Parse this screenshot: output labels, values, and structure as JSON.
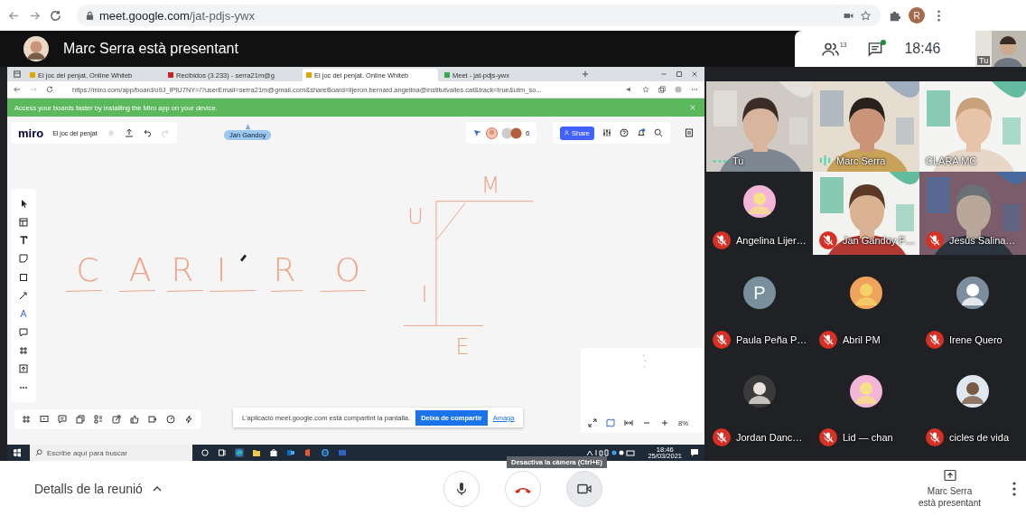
{
  "browser": {
    "url_host": "meet.google.com",
    "url_path": "/jat-pdjs-ywx",
    "profile_initial": "R"
  },
  "meeting": {
    "presenter_banner": "Marc Serra està presentant",
    "participant_count": "13",
    "chat_unread": true,
    "time": "18:46",
    "self_label": "Tu"
  },
  "shared_screen": {
    "tabs": [
      {
        "title": "El joc del penjat, Online Whiteb",
        "selected": false
      },
      {
        "title": "Recibidos (3.233) - serra21m@g",
        "selected": false
      },
      {
        "title": "El joc del penjat. Online Whiteb",
        "selected": true
      },
      {
        "title": "Meet - jat-pdjs-ywx",
        "selected": false
      }
    ],
    "url": "https://miro.com/app/board/o9J_lPtU7NY=/?userEmail=serra21m@gmail.com&shareBoard=lijeron.bernard.angelina@institutvalles.cat&track=true&utm_so...",
    "banner": "Access your boards faster by installing the Miro app on your device.",
    "app_logo": "miro",
    "board_name": "El joc del penjat",
    "cursor_user": "Jan Gandoy",
    "collaborator_count": "6",
    "share_button": "Share",
    "word_letters": [
      "C",
      "A",
      "R",
      "I",
      "R",
      "O"
    ],
    "wrong_letters": [
      "M",
      "U",
      "I",
      "E"
    ],
    "share_notice": {
      "text": "L'aplicació meet.google.com està compartint la pantalla.",
      "stop_button": "Deixa de compartir",
      "hide_link": "Amaga"
    },
    "zoom": "8%",
    "taskbar": {
      "search_placeholder": "Escribe aquí para buscar",
      "time": "18:46",
      "date": "25/03/2021"
    }
  },
  "participants": [
    {
      "name": "Tu",
      "kind": "video",
      "muted": false,
      "speaking": false
    },
    {
      "name": "Marc Serra",
      "kind": "video",
      "muted": false,
      "speaking": true
    },
    {
      "name": "CLARA MC",
      "kind": "video",
      "muted": false
    },
    {
      "name": "Angelina Lijer…",
      "kind": "avatar",
      "muted": true
    },
    {
      "name": "Jan Gandoy F…",
      "kind": "video",
      "muted": true
    },
    {
      "name": "Jesús Salina…",
      "kind": "video",
      "muted": true
    },
    {
      "name": "Paula Peña P…",
      "kind": "avatar",
      "initial": "P",
      "muted": true
    },
    {
      "name": "Abril PM",
      "kind": "avatar",
      "muted": true
    },
    {
      "name": "Irene Quero",
      "kind": "avatar",
      "muted": true
    },
    {
      "name": "Jordan Danc…",
      "kind": "avatar",
      "muted": true
    },
    {
      "name": "Lid — chan",
      "kind": "avatar",
      "muted": true
    },
    {
      "name": "cicles de vida",
      "kind": "avatar",
      "muted": true
    }
  ],
  "bottom_bar": {
    "details": "Detalls de la reunió",
    "mic_on": true,
    "camera_on": true,
    "camera_tooltip": "Desactiva la càmera (Ctrl+E)",
    "presenting": [
      "Marc Serra",
      "està presentant"
    ]
  }
}
